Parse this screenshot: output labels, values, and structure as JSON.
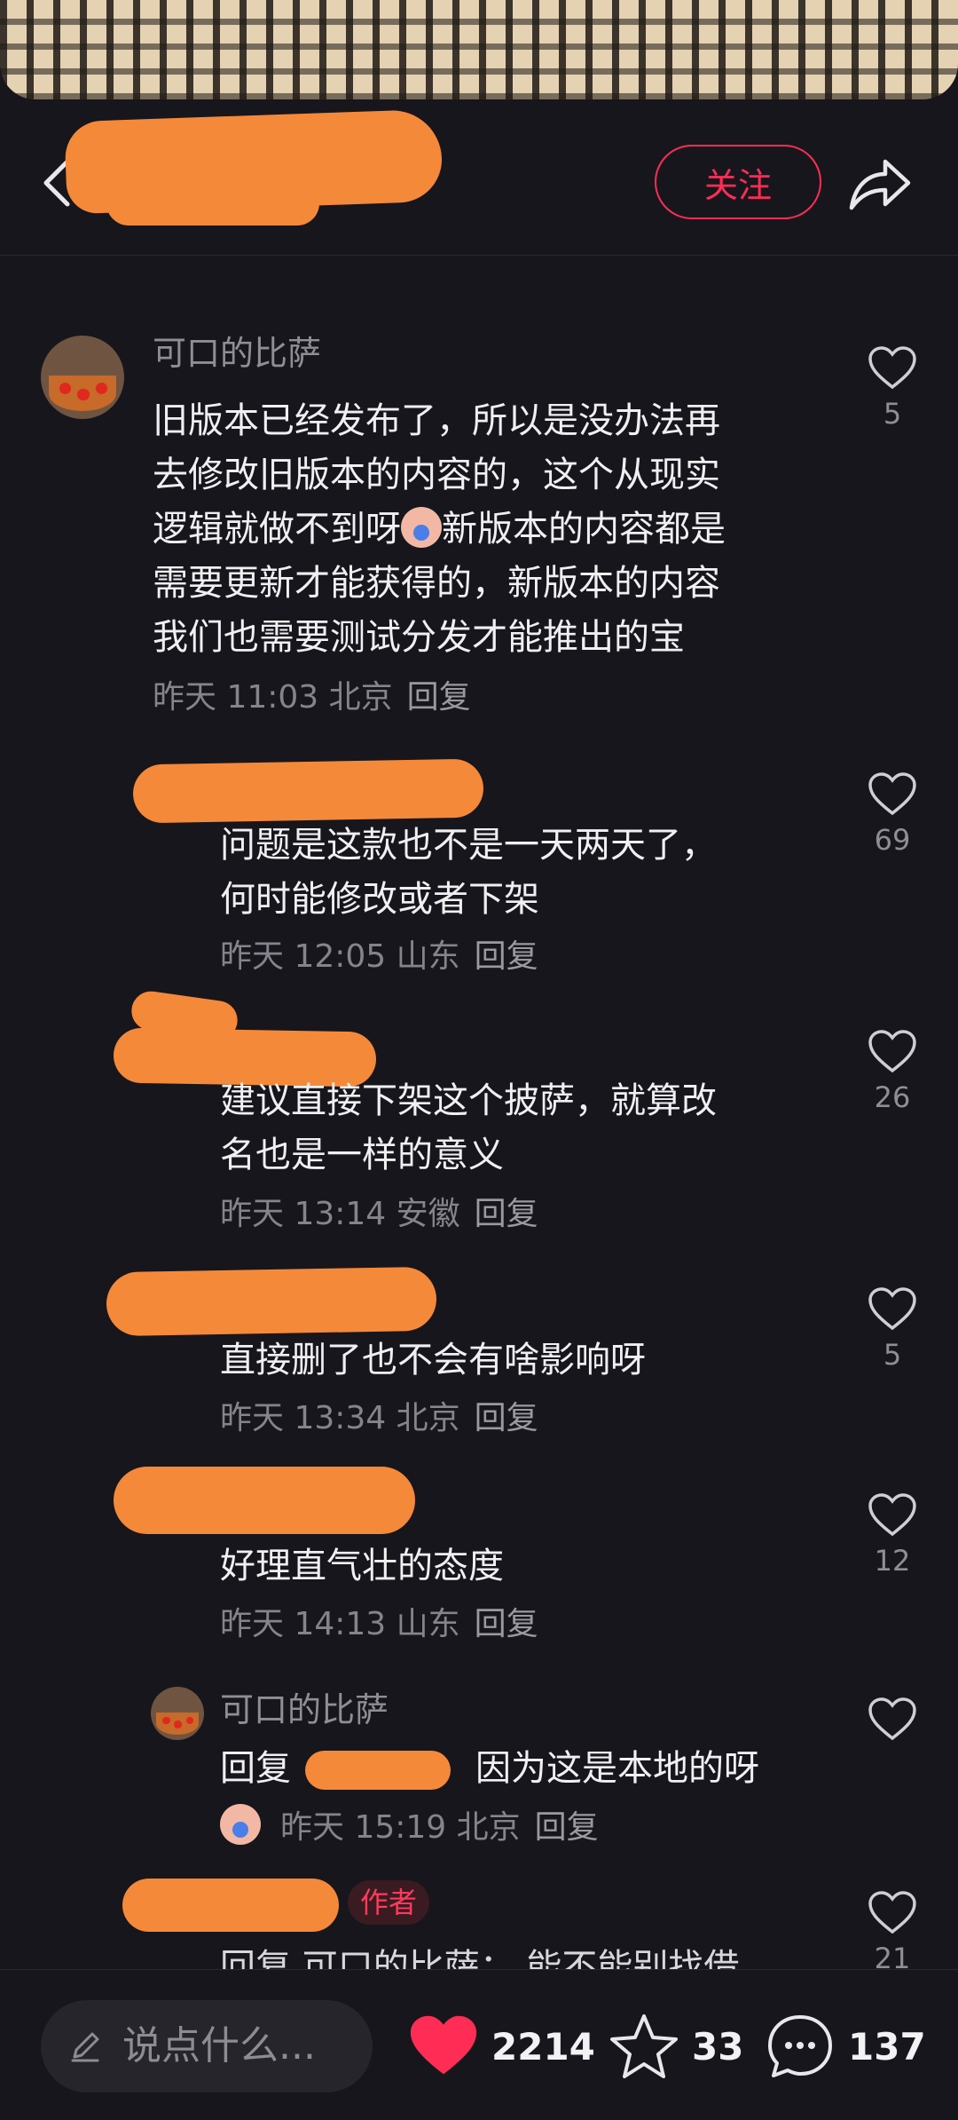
{
  "header": {
    "follow_label": "关注"
  },
  "comments": [
    {
      "author": "可口的比萨",
      "lines": [
        "旧版本已经发布了，所以是没办法再",
        "去修改旧版本的内容的，这个从现实",
        "逻辑就做不到呀",
        "新版本的内容都是",
        "需要更新才能获得的，新版本的内容",
        "我们也需要测试分发才能推出的宝"
      ],
      "time": "昨天 11:03",
      "location": "北京",
      "reply": "回复",
      "likes": "5"
    },
    {
      "lines": [
        "问题是这款也不是一天两天了，",
        "何时能修改或者下架"
      ],
      "time": "昨天 12:05",
      "location": "山东",
      "reply": "回复",
      "likes": "69"
    },
    {
      "lines": [
        "建议直接下架这个披萨，就算改",
        "名也是一样的意义"
      ],
      "time": "昨天 13:14",
      "location": "安徽",
      "reply": "回复",
      "likes": "26"
    },
    {
      "lines": [
        "直接删了也不会有啥影响呀"
      ],
      "time": "昨天 13:34",
      "location": "北京",
      "reply": "回复",
      "likes": "5"
    },
    {
      "lines": [
        "好理直气壮的态度"
      ],
      "time": "昨天 14:13",
      "location": "山东",
      "reply": "回复",
      "likes": "12"
    },
    {
      "author": "可口的比萨",
      "reply_prefix": "回复",
      "text": "因为这是本地的呀",
      "time": "昨天 15:19",
      "location": "北京",
      "reply": "回复"
    },
    {
      "badge": "作者",
      "partial_text": "回复  可口的比萨：  能不能别找借",
      "likes": "21"
    }
  ],
  "bottom_bar": {
    "input_placeholder": "说点什么...",
    "likes": "2214",
    "favorites": "33",
    "comments": "137"
  },
  "colors": {
    "accent": "#ff2d55",
    "redaction": "#f5893a",
    "background": "#17161c"
  }
}
